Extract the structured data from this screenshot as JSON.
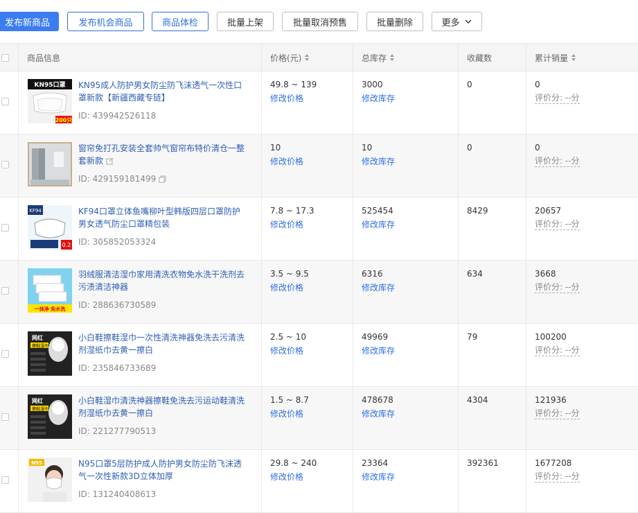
{
  "toolbar": {
    "publish": "发布新商品",
    "opportunity": "发布机会商品",
    "check": "商品体检",
    "batch_on": "批量上架",
    "batch_cancel_presale": "批量取消预售",
    "batch_delete": "批量删除",
    "more": "更多"
  },
  "table": {
    "headers": {
      "info": "商品信息",
      "price": "价格(元)",
      "stock": "总库存",
      "fav": "收藏数",
      "sales": "累计销量"
    },
    "edit_price": "修改价格",
    "edit_stock": "修改库存",
    "rows": [
      {
        "title": "KN95成人防护男女防尘防飞沫透气一次性口罩新款【新疆西藏专链】",
        "id": "ID: 439942526118",
        "price": "49.8 ~ 139",
        "stock": "3000",
        "fav": "0",
        "sales": "0",
        "rating": "评价分: --分",
        "thumb_top": "KN95口罩",
        "thumb_bottom": "200只"
      },
      {
        "title": "窗帘免打孔安装全套帅气窗帘布特价清仓一整套新款",
        "id": "ID: 429159181499",
        "price": "10",
        "stock": "10",
        "fav": "0",
        "sales": "0",
        "rating": "评价分: --分"
      },
      {
        "title": "KF94口罩立体鱼嘴柳叶型韩版四层口罩防护男女透气防尘口罩精包装",
        "id": "ID: 305852053324",
        "price": "7.8 ~ 17.3",
        "stock": "525454",
        "fav": "8429",
        "sales": "20657",
        "rating": "评价分: --分",
        "thumb_top": "KF94",
        "thumb_bottom": "0.2"
      },
      {
        "title": "羽绒服清洁湿巾家用清洗衣物免水洗干洗剂去污渍清洁神器",
        "id": "ID: 288636730589",
        "price": "3.5 ~ 9.5",
        "stock": "6316",
        "fav": "634",
        "sales": "3668",
        "rating": "评价分: --分",
        "thumb_bottom": "一抹净 免水洗"
      },
      {
        "title": "小白鞋擦鞋湿巾一次性清洗神器免洗去污清洗剂湿纸巾去黄一擦白",
        "id": "ID: 235846733689",
        "price": "2.5 ~ 10",
        "stock": "49969",
        "fav": "79",
        "sales": "100200",
        "rating": "评价分: --分",
        "thumb_top": "网红 擦鞋湿巾"
      },
      {
        "title": "小白鞋湿巾清洗神器擦鞋免洗去污运动鞋清洗剂湿纸巾去黄一擦白",
        "id": "ID: 221277790513",
        "price": "1.5 ~ 8.7",
        "stock": "478678",
        "fav": "4304",
        "sales": "121936",
        "rating": "评价分: --分",
        "thumb_top": "网红 擦鞋湿巾"
      },
      {
        "title": "N95口罩5层防护成人防护男女防尘防飞沫透气一次性新款3D立体加厚",
        "id": "ID: 131240408613",
        "price": "29.8 ~ 240",
        "stock": "23364",
        "fav": "392361",
        "sales": "1677208",
        "rating": "评价分: --分",
        "thumb_top": "N95"
      }
    ]
  },
  "colors": {
    "primary": "#3b7cf1",
    "link": "#2f6fe4",
    "title": "#2f5fb3"
  }
}
